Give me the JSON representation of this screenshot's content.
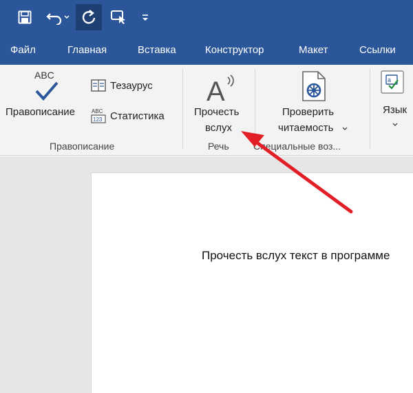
{
  "quick_access": {
    "save": "save-icon",
    "undo": "undo-icon",
    "redo": "redo-icon",
    "touch": "touch-mode-icon",
    "customize": "customize-icon"
  },
  "tabs": [
    "Файл",
    "Главная",
    "Вставка",
    "Конструктор",
    "Макет",
    "Ссылки"
  ],
  "ribbon": {
    "proofing": {
      "abc_label": "ABC",
      "spelling_label": "Правописание",
      "thesaurus_label": "Тезаурус",
      "statistics_label": "Статистика",
      "group_label": "Правописание"
    },
    "speech": {
      "read_aloud_line1": "Прочесть",
      "read_aloud_line2": "вслух",
      "group_label": "Речь"
    },
    "accessibility": {
      "check_line1": "Проверить",
      "check_line2": "читаемость",
      "group_label": "Специальные воз..."
    },
    "language": {
      "label": "Язык"
    }
  },
  "document": {
    "text": "Прочесть вслух текст в программе"
  },
  "colors": {
    "ribbon_blue": "#2b579a",
    "annotation_arrow": "#e21f26"
  }
}
